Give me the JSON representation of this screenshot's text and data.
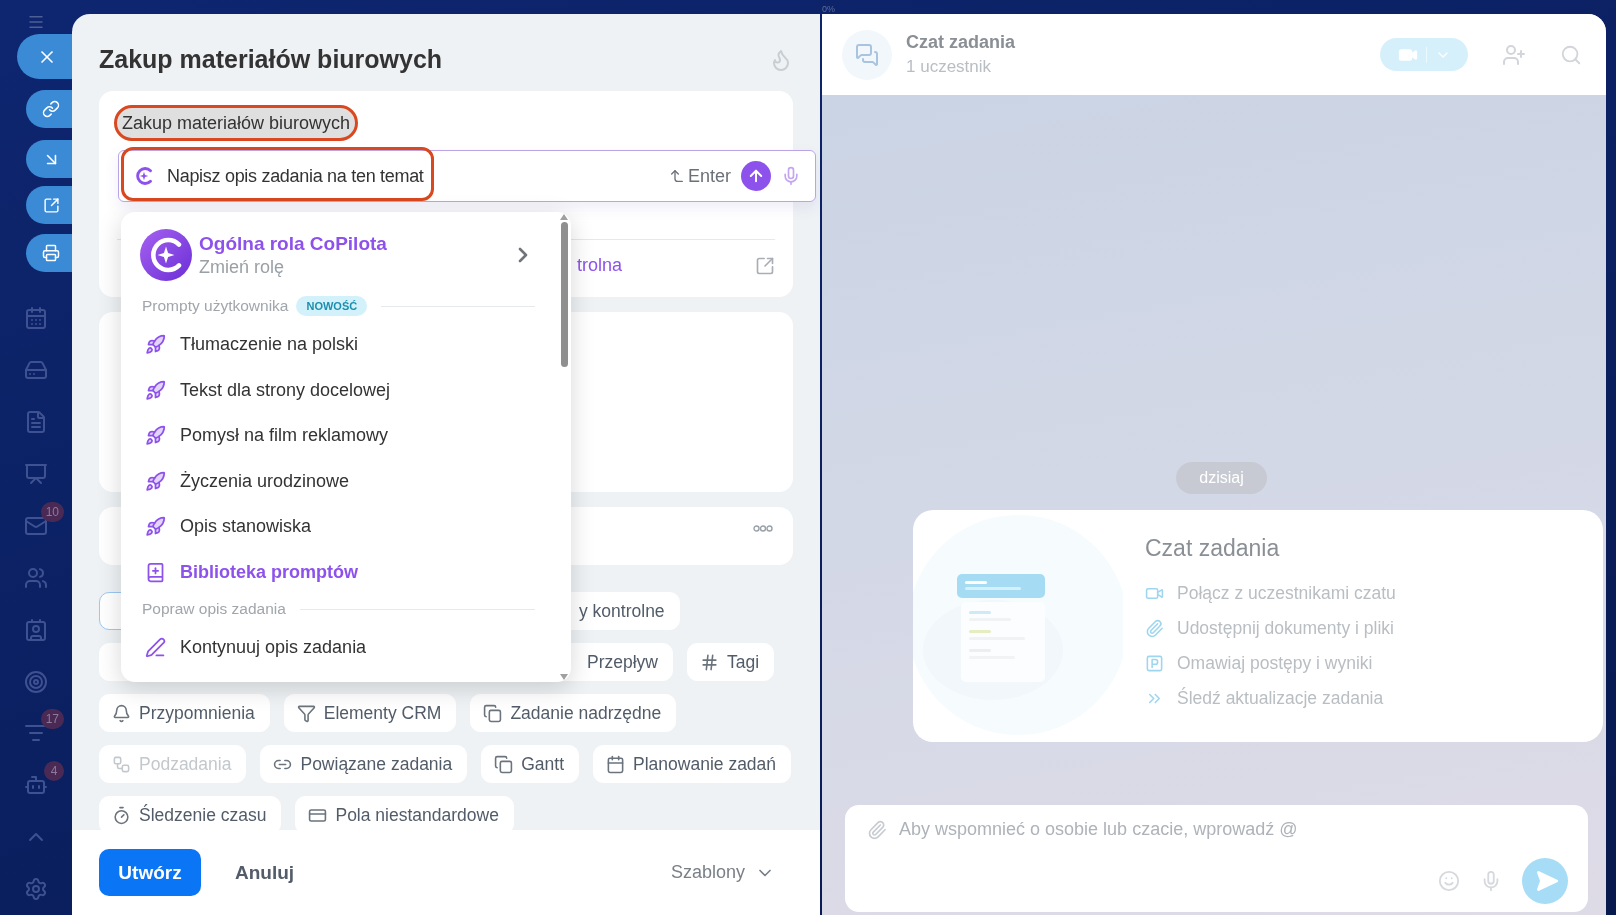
{
  "sidebar_badges": [
    "10",
    "17",
    "4"
  ],
  "progress_label": "0%",
  "task": {
    "title": "Zakup materiałów biurowych",
    "name_field": {
      "value": "Zakup materiałów biurowych",
      "highlighted": true
    },
    "ai_prompt": {
      "value": "Napisz opis zadania na ten temat",
      "hint": "Enter",
      "highlighted": true
    },
    "checklist_link": "trolna",
    "chip_rows": [
      [
        {
          "selected": true
        },
        {
          "label": "y kontrolne",
          "selected": false,
          "disabled": false
        }
      ],
      [
        {},
        {
          "label": "Przepływ",
          "selected": false,
          "disabled": false
        },
        {
          "label": "Tagi",
          "selected": false,
          "disabled": false
        }
      ],
      [
        {
          "label": "Przypomnienia",
          "selected": false,
          "disabled": false
        },
        {
          "label": "Elementy CRM",
          "selected": false,
          "disabled": false
        },
        {
          "label": "Zadanie nadrzędne",
          "selected": false,
          "disabled": false
        }
      ],
      [
        {
          "label": "Podzadania",
          "selected": false,
          "disabled": true
        },
        {
          "label": "Powiązane zadania",
          "selected": false,
          "disabled": false
        },
        {
          "label": "Gantt",
          "selected": false,
          "disabled": false
        },
        {
          "label": "Planowanie zadań",
          "selected": false,
          "disabled": false
        }
      ],
      [
        {
          "label": "Śledzenie czasu",
          "selected": false,
          "disabled": false
        },
        {
          "label": "Pola niestandardowe",
          "selected": false,
          "disabled": false
        }
      ]
    ],
    "footer": {
      "create": "Utwórz",
      "cancel": "Anuluj",
      "templates": "Szablony"
    }
  },
  "copilot_menu": {
    "role": {
      "title": "Ogólna rola CoPilota",
      "subtitle": "Zmień rolę"
    },
    "sections": [
      {
        "title": "Prompty użytkownika",
        "badge": "NOWOŚĆ",
        "items": [
          {
            "label": "Tłumaczenie na polski",
            "kind": "prompt"
          },
          {
            "label": "Tekst dla strony docelowej",
            "kind": "prompt"
          },
          {
            "label": "Pomysł na film reklamowy",
            "kind": "prompt"
          },
          {
            "label": "Życzenia urodzinowe",
            "kind": "prompt"
          },
          {
            "label": "Opis stanowiska",
            "kind": "prompt"
          },
          {
            "label": "Biblioteka promptów",
            "kind": "library"
          }
        ]
      },
      {
        "title": "Popraw opis zadania",
        "items": [
          {
            "label": "Kontynuuj opis zadania",
            "kind": "edit"
          }
        ]
      }
    ]
  },
  "chat": {
    "title": "Czat zadania",
    "subtitle": "1 uczestnik",
    "date": "dzisiaj",
    "intro": {
      "title": "Czat zadania",
      "features": [
        "Połącz z uczestnikami czatu",
        "Udostępnij dokumenty i pliki",
        "Omawiaj postępy i wyniki",
        "Śledź aktualizacje zadania"
      ]
    },
    "input": {
      "placeholder": "Aby wspomnieć o osobie lub czacie, wprowadź @"
    }
  }
}
